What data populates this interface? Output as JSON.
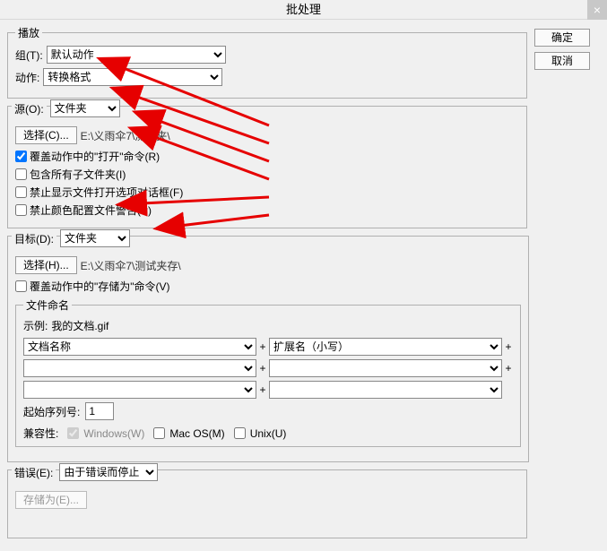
{
  "title": "批处理",
  "buttons": {
    "ok": "确定",
    "cancel": "取消",
    "select_c": "选择(C)...",
    "select_h": "选择(H)...",
    "saveas": "存储为(E)..."
  },
  "play": {
    "legend": "播放",
    "group_label": "组(T):",
    "group_value": "默认动作",
    "action_label": "动作:",
    "action_value": "转换格式"
  },
  "source": {
    "label": "源(O):",
    "value": "文件夹",
    "path": "E:\\义雨伞7\\测试夹\\",
    "cb_override_open": "覆盖动作中的\"打开\"命令(R)",
    "cb_subfolders": "包含所有子文件夹(I)",
    "cb_suppress_dialog": "禁止显示文件打开选项对话框(F)",
    "cb_suppress_profile": "禁止颜色配置文件警告(P)"
  },
  "dest": {
    "label": "目标(D):",
    "value": "文件夹",
    "path": "E:\\义雨伞7\\测试夹存\\",
    "cb_override_save": "覆盖动作中的\"存储为\"命令(V)",
    "naming_legend": "文件命名",
    "example_label": "示例:",
    "example_value": "我的文档.gif",
    "name1": "文档名称",
    "name2": "扩展名（小写）",
    "plus": "+",
    "seq_label": "起始序列号:",
    "seq_value": "1",
    "compat_label": "兼容性:",
    "compat_win": "Windows(W)",
    "compat_mac": "Mac OS(M)",
    "compat_unix": "Unix(U)"
  },
  "error": {
    "label": "错误(E):",
    "value": "由于错误而停止"
  }
}
